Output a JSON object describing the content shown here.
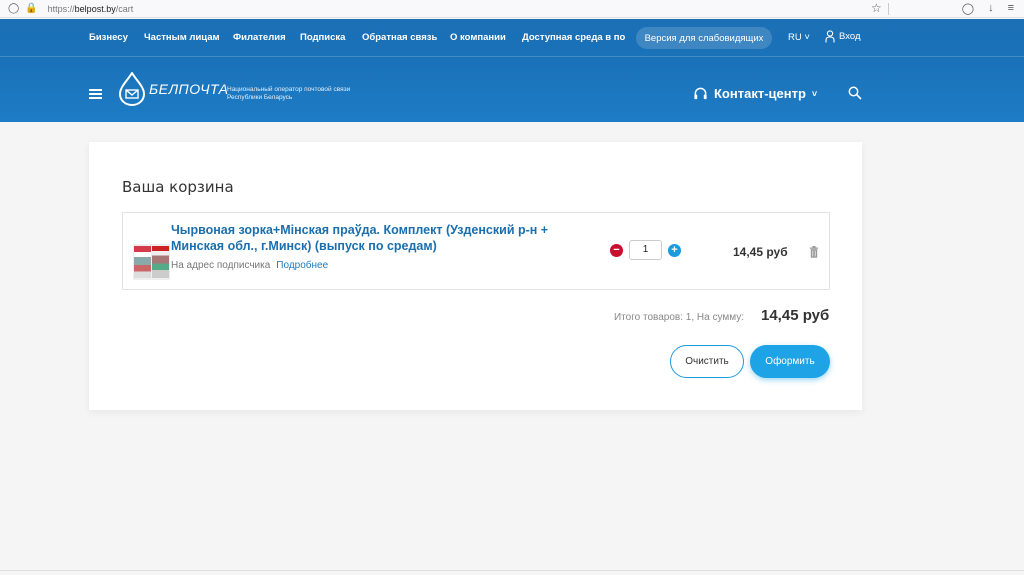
{
  "browser": {
    "url_prefix": "https://",
    "url_domain": "belpost.by",
    "url_path": "/cart"
  },
  "topnav": {
    "items": [
      "Бизнесу",
      "Частным лицам",
      "Филателия",
      "Подписка",
      "Обратная связь",
      "О компании",
      "Доступная среда в по"
    ],
    "vision_button": "Версия для слабовидящих",
    "language": "RU",
    "login": "Вход"
  },
  "header": {
    "logo_text": "БЕЛПОЧТА",
    "tagline_line1": "Национальный оператор почтовой связи",
    "tagline_line2": "Республики Беларусь",
    "contact_center": "Контакт-центр"
  },
  "cart": {
    "title": "Ваша корзина",
    "items": [
      {
        "name": "Чырвоная зорка+Мінская праўда. Комплект (Узденский р-н + Минская обл., г.Минск) (выпуск по средам)",
        "delivery": "На адрес подписчика",
        "more_link": "Подробнее",
        "quantity": "1",
        "price": "14,45 руб"
      }
    ],
    "summary_label": "Итого товаров: 1, На сумму:",
    "summary_total": "14,45 руб",
    "clear_button": "Очистить",
    "checkout_button": "Оформить"
  },
  "colors": {
    "header_blue": "#1a72b9",
    "link_blue": "#1a6fae",
    "accent_blue": "#1ea3e6",
    "minus_red": "#c8102e"
  }
}
